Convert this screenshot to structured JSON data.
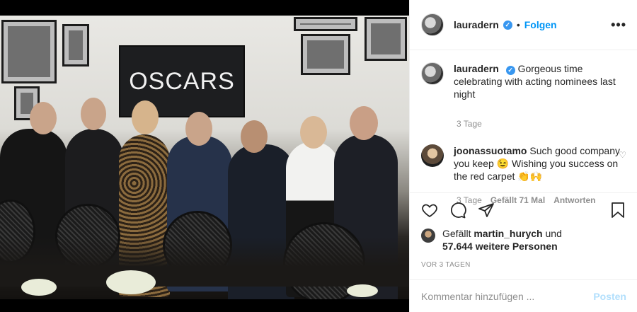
{
  "header": {
    "username": "lauradern",
    "dot": "•",
    "follow_label": "Folgen",
    "more_label": "•••"
  },
  "photo": {
    "screen_text": "OSCARS"
  },
  "caption": {
    "username": "lauradern",
    "text": "Gorgeous time celebrating with acting nominees last night",
    "time": "3 Tage"
  },
  "comments": [
    {
      "username": "joonassuotamo",
      "text": "Such good company you keep 😉 Wishing you success on the red carpet 👏🙌",
      "time": "3 Tage",
      "likes": "Gefällt 71 Mal",
      "reply_label": "Antworten"
    }
  ],
  "likes": {
    "prefix": "Gefällt",
    "liked_by": "martin_hurych",
    "and": "und",
    "count_text": "57.644 weitere Personen"
  },
  "timestamp": "VOR 3 TAGEN",
  "add_comment": {
    "placeholder": "Kommentar hinzufügen ...",
    "post_label": "Posten"
  },
  "colors": {
    "accent": "#0095f6",
    "verified": "#3897f0",
    "post_disabled": "#b2dffc",
    "muted": "#8e8e8e"
  }
}
